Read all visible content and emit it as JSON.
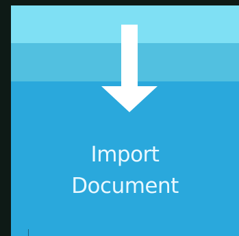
{
  "tile": {
    "line1": "Import",
    "line2": "Document",
    "icon": "arrow-down-icon",
    "colors": {
      "background": "#2aa8dc",
      "band_top": "#7fe0f4",
      "band_mid": "#52c0e0",
      "text": "#e9f8ff",
      "page": "#0e1a16"
    }
  }
}
